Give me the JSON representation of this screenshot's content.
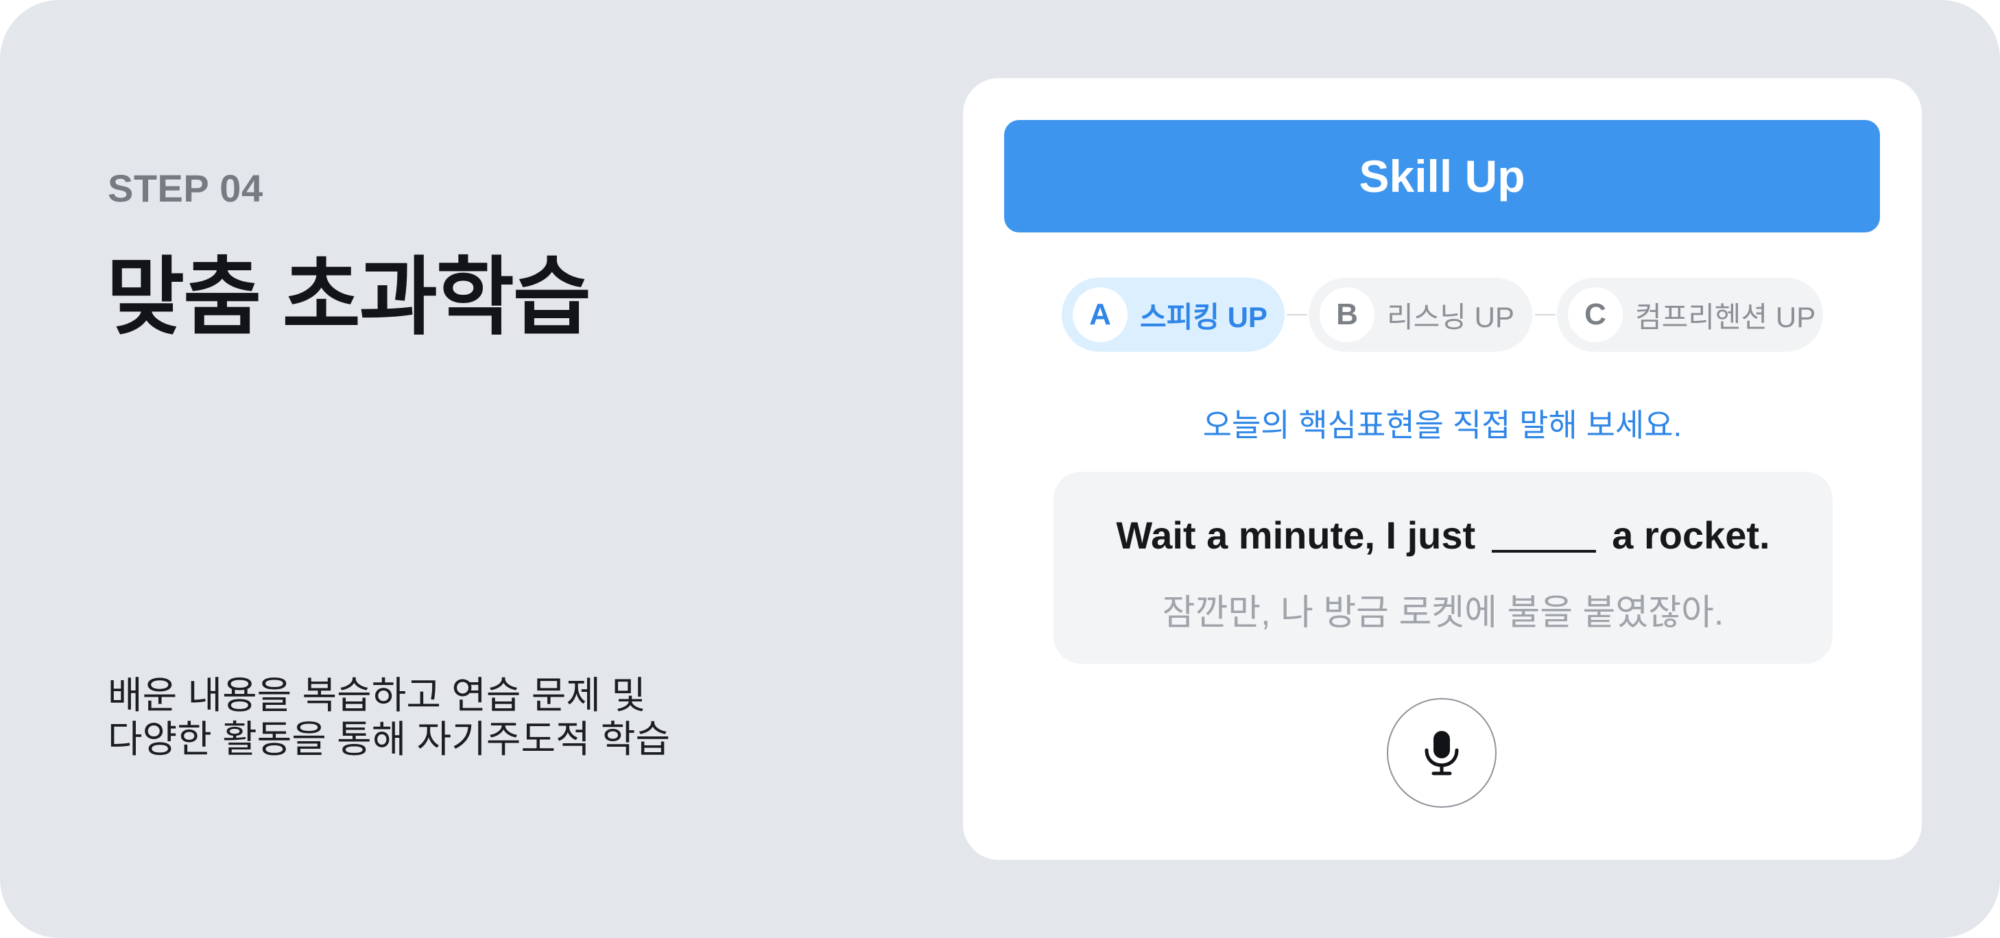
{
  "step_label": "STEP 04",
  "title": "맞춤 초과학습",
  "description": {
    "line1": "배운 내용을 복습하고 연습 문제 및",
    "line2": "다양한 활동을 통해 자기주도적 학습"
  },
  "card": {
    "skill_button": "Skill Up",
    "tabs": [
      {
        "letter": "A",
        "label": "스피킹 UP",
        "active": true
      },
      {
        "letter": "B",
        "label": "리스닝 UP",
        "active": false
      },
      {
        "letter": "C",
        "label": "컴프리헨션 UP",
        "active": false
      }
    ],
    "instruction": "오늘의 핵심표현을 직접 말해 보세요.",
    "sentence_before": "Wait a minute, I just",
    "sentence_after": "a rocket.",
    "translation": "잠깐만, 나 방금 로켓에 불을 붙였잖아.",
    "mic_icon": "microphone-icon"
  },
  "colors": {
    "background": "#e3e7ec",
    "accent": "#3d95ee",
    "accent_text": "#2f86e8",
    "active_tab_bg": "#dcefff"
  }
}
